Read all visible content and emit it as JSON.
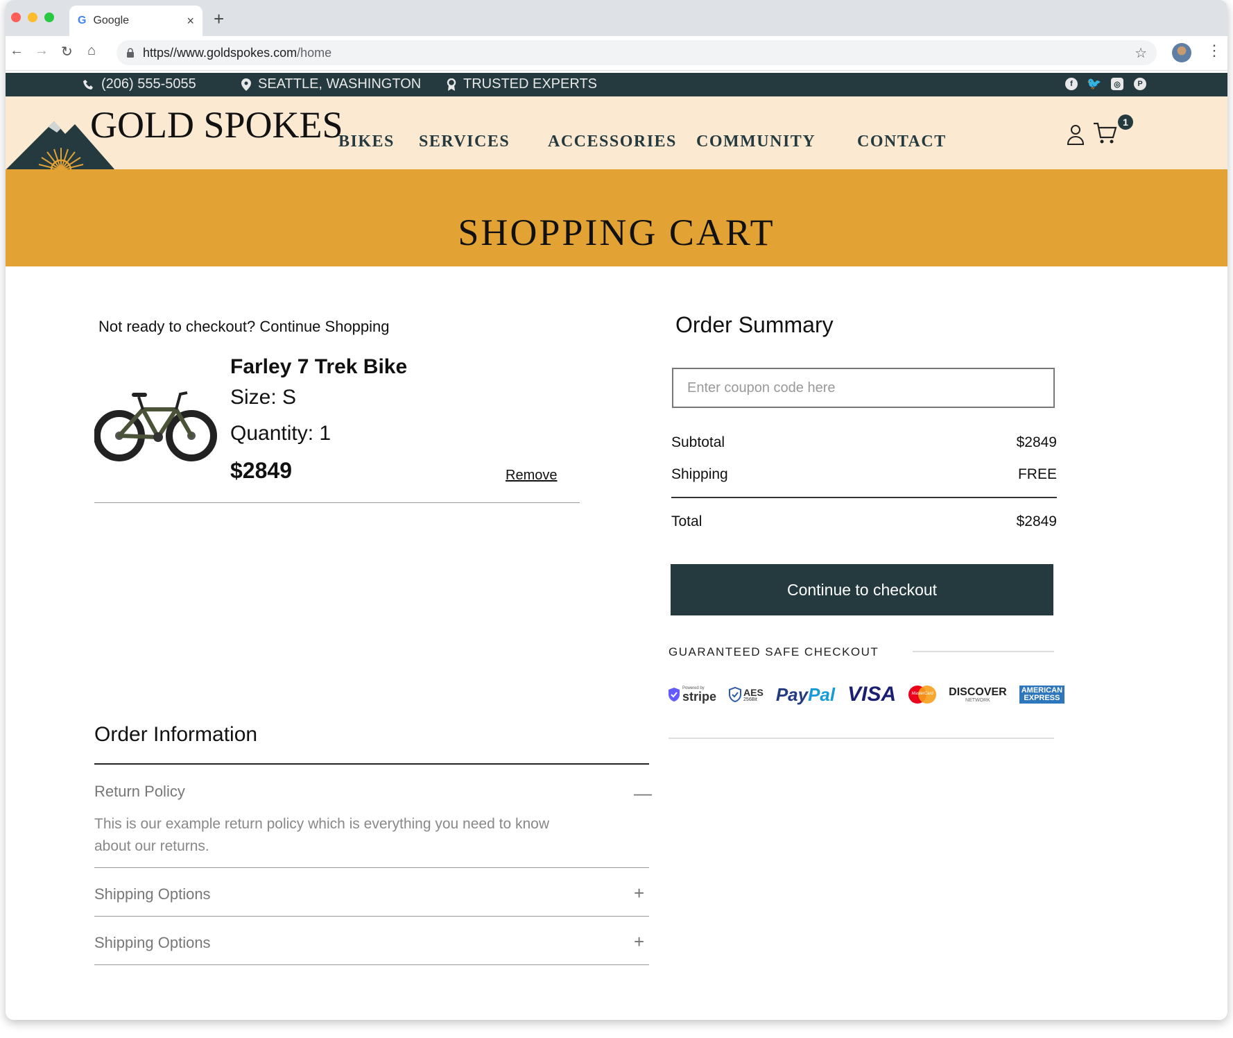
{
  "browser": {
    "tab_title": "Google",
    "tab_favicon": "G",
    "url_host": "https//www.goldspokes.com",
    "url_path": "/home"
  },
  "topbar": {
    "phone": "(206) 555-5055",
    "location": "SEATTLE, WASHINGTON",
    "trust": "TRUSTED EXPERTS",
    "social": [
      "facebook-icon",
      "twitter-icon",
      "instagram-icon",
      "pinterest-icon"
    ]
  },
  "header": {
    "logo": "GOLD SPOKES",
    "nav": [
      "BIKES",
      "SERVICES",
      "ACCESSORIES",
      "COMMUNITY",
      "CONTACT"
    ],
    "cart_count": "1"
  },
  "banner": {
    "title": "SHOPPING CART"
  },
  "cart": {
    "continue_text": "Not ready to checkout? Continue Shopping",
    "item": {
      "name": "Farley 7 Trek Bike",
      "size": "Size: S",
      "quantity": "Quantity: 1",
      "price": "$2849",
      "remove": "Remove"
    }
  },
  "summary": {
    "title": "Order Summary",
    "coupon_placeholder": "Enter coupon code here",
    "subtotal_label": "Subtotal",
    "subtotal_value": "$2849",
    "shipping_label": "Shipping",
    "shipping_value": "FREE",
    "total_label": "Total",
    "total_value": "$2849",
    "checkout_button": "Continue to checkout",
    "safe_checkout": "GUARANTEED SAFE CHECKOUT",
    "payment_logos": {
      "stripe_small": "Powered by",
      "stripe": "stripe",
      "aes": "AES",
      "aes_small": "256Bit",
      "paypal_a": "Pay",
      "paypal_b": "Pal",
      "visa": "VISA",
      "mastercard": "MasterCard",
      "discover": "DISCOVER",
      "discover_small": "NETWORK",
      "amex_1": "AMERICAN",
      "amex_2": "EXPRESS"
    }
  },
  "order_info": {
    "title": "Order Information",
    "sections": [
      {
        "title": "Return Policy",
        "toggle": "—",
        "body": "This is our example return policy which is everything you need to know about our returns."
      },
      {
        "title": "Shipping Options",
        "toggle": "+"
      },
      {
        "title": "Shipping Options",
        "toggle": "+"
      }
    ]
  },
  "colors": {
    "dark_teal": "#243a3f",
    "gold": "#e3a234",
    "cream": "#fbe9d2"
  }
}
